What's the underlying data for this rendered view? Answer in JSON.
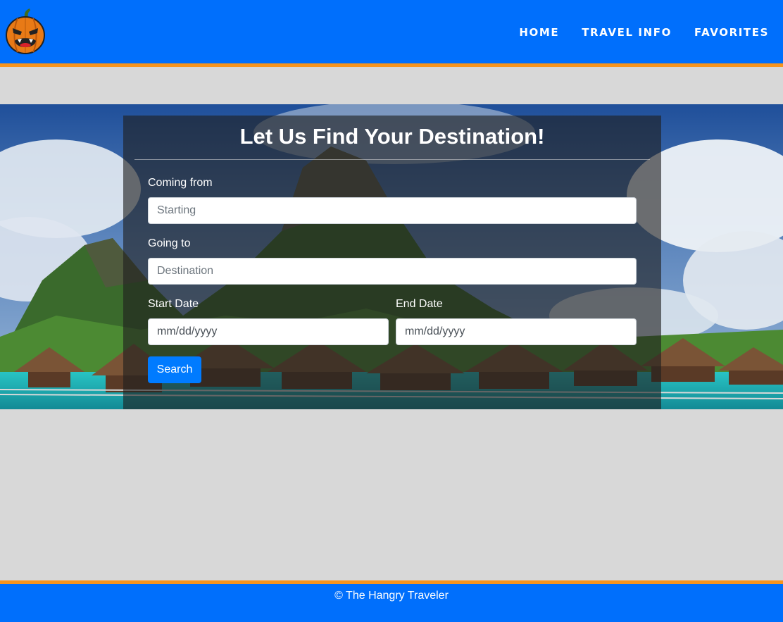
{
  "nav": {
    "logo": "pumpkin-logo-icon",
    "links": [
      "HOME",
      "TRAVEL INFO",
      "FAVORITES"
    ]
  },
  "form": {
    "title": "Let Us Find Your Destination!",
    "origin_label": "Coming from",
    "origin_placeholder": "Starting",
    "destination_label": "Going to",
    "destination_placeholder": "Destination",
    "start_label": "Start Date",
    "start_placeholder": "mm/dd/yyyy",
    "end_label": "End Date",
    "end_placeholder": "mm/dd/yyyy",
    "search_label": "Search"
  },
  "footer": {
    "text": "© The Hangry Traveler"
  },
  "colors": {
    "brand_blue": "#006ffc",
    "accent_orange": "#f7941d",
    "button_blue": "#007bff",
    "page_background": "#d8d8d8"
  }
}
